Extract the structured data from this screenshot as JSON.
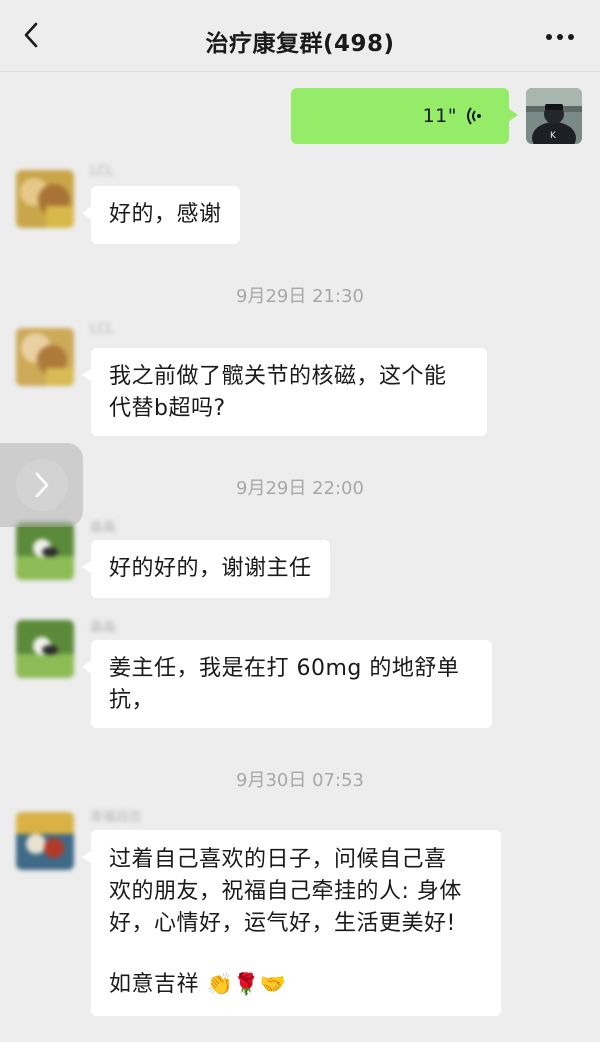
{
  "header": {
    "title": "治疗康复群(498)",
    "back_icon": "chevron-left-icon",
    "more_icon": "more-dots-icon"
  },
  "colors": {
    "background": "#ededed",
    "self_bubble": "#95ec69",
    "other_bubble": "#ffffff",
    "timestamp": "#a8a8a8"
  },
  "messages": [
    {
      "type": "voice",
      "from": "self",
      "duration": "11\""
    },
    {
      "type": "text",
      "from": "other",
      "sender": "LCL",
      "text": "好的，感谢"
    },
    {
      "type": "time",
      "text": "9月29日 21:30"
    },
    {
      "type": "text",
      "from": "other",
      "sender": "LCL",
      "line1": "我之前做了髋关节的核磁，这个能",
      "line2": "代替b超吗?"
    },
    {
      "type": "time",
      "text": "9月29日 22:00"
    },
    {
      "type": "text",
      "from": "other",
      "sender": "淼淼",
      "text": "好的好的，谢谢主任"
    },
    {
      "type": "text",
      "from": "other",
      "sender": "淼淼",
      "line1": "姜主任，我是在打 60mg 的地舒单",
      "line2": "抗，"
    },
    {
      "type": "time",
      "text": "9月30日 07:53"
    },
    {
      "type": "text",
      "from": "other",
      "sender": "幸福自在",
      "line1": "过着自己喜欢的日子，问候自己喜",
      "line2": "欢的朋友，祝福自己牵挂的人: 身体",
      "line3": "好，心情好，运气好，生活更美好!",
      "line4": "如意吉祥",
      "emojis": "👏🌹🤝"
    }
  ],
  "floating_button": {
    "icon": "chevron-right-icon"
  }
}
